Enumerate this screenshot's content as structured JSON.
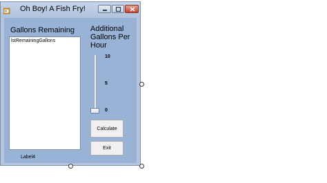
{
  "window": {
    "title": "Oh Boy! A Fish Fry!",
    "icon": "app-form-icon",
    "controls": [
      "minimize-icon",
      "maximize-icon",
      "close-icon"
    ]
  },
  "form": {
    "gallons_label": "Gallons Remaining",
    "listbox_item": "lstRemainingGallons",
    "additional_label": "Additional Gallons Per Hour",
    "slider": {
      "max_label": "10",
      "mid_label": "5",
      "min_label": "0",
      "value": 0
    },
    "calculate_button": "Calculate",
    "exit_button": "Exit",
    "status_label": "Label4"
  },
  "colors": {
    "client_background": "#98b3d6",
    "title_bar": "#b1c4dc",
    "close_button": "#c8442e"
  }
}
